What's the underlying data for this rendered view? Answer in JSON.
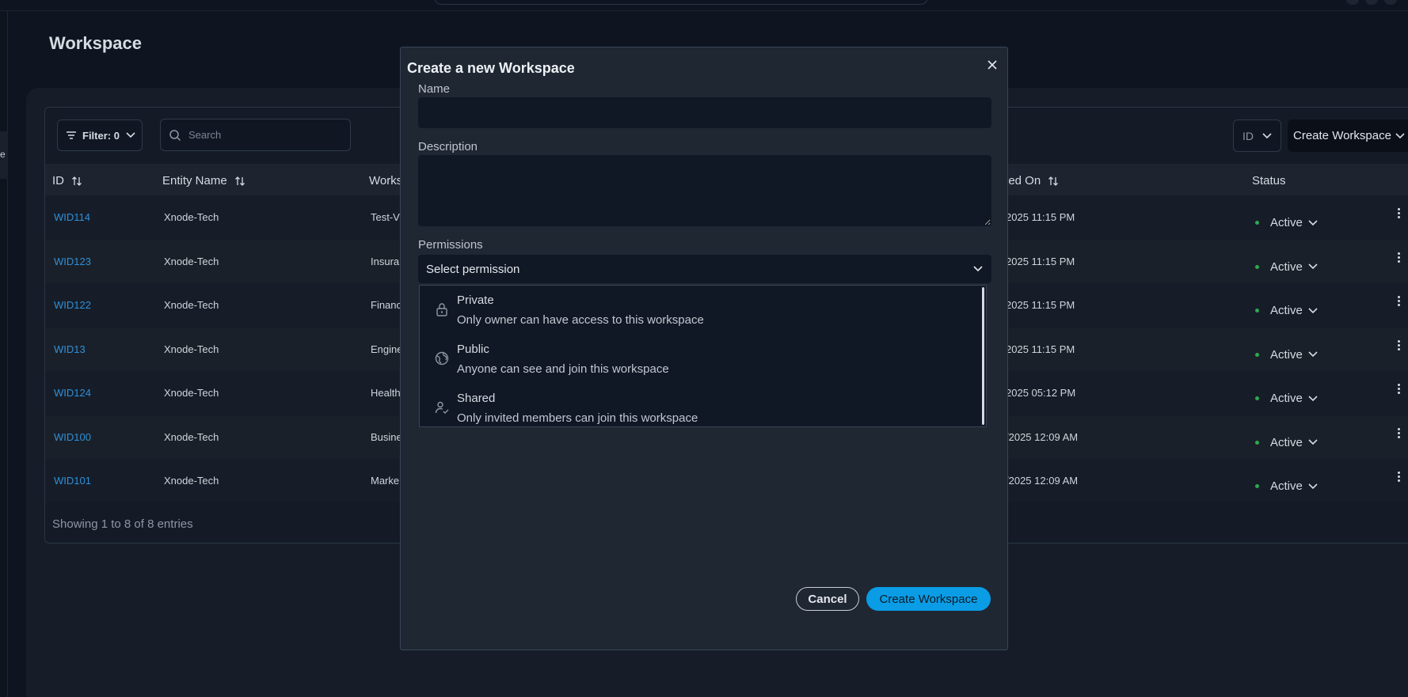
{
  "page": {
    "title": "Workspace"
  },
  "toolbar": {
    "filter_label": "Filter: 0",
    "search_placeholder": "Search",
    "id_select_value": "ID",
    "create_label": "Create Workspace"
  },
  "table": {
    "headers": {
      "id": "ID",
      "entity": "Entity Name",
      "workspace": "Works",
      "modified": "ied On",
      "status": "Status"
    },
    "rows": [
      {
        "id": "WID114",
        "entity": "Xnode-Tech",
        "workspace": "Test-V",
        "date": "2025 11:15 PM",
        "status": "Active"
      },
      {
        "id": "WID123",
        "entity": "Xnode-Tech",
        "workspace": "Insura",
        "date": "2025 11:15 PM",
        "status": "Active"
      },
      {
        "id": "WID122",
        "entity": "Xnode-Tech",
        "workspace": "Financ",
        "date": "2025 11:15 PM",
        "status": "Active"
      },
      {
        "id": "WID13",
        "entity": "Xnode-Tech",
        "workspace": "Engine",
        "date": "2025 11:15 PM",
        "status": "Active"
      },
      {
        "id": "WID124",
        "entity": "Xnode-Tech",
        "workspace": "Health",
        "date": "2025 05:12 PM",
        "status": "Active"
      },
      {
        "id": "WID100",
        "entity": "Xnode-Tech",
        "workspace": "Busine",
        "date": "/2025 12:09 AM",
        "status": "Active"
      },
      {
        "id": "WID101",
        "entity": "Xnode-Tech",
        "workspace": "Marke",
        "date": "/2025 12:09 AM",
        "status": "Active"
      }
    ],
    "footer": "Showing 1 to 8 of 8 entries"
  },
  "modal": {
    "title": "Create a new Workspace",
    "name_label": "Name",
    "name_value": "",
    "description_label": "Description",
    "description_value": "",
    "permissions_label": "Permissions",
    "permissions_placeholder": "Select permission",
    "options": [
      {
        "title": "Private",
        "description": "Only owner can have access to this workspace",
        "icon": "lock-icon"
      },
      {
        "title": "Public",
        "description": "Anyone can see and join this workspace",
        "icon": "globe-icon"
      },
      {
        "title": "Shared",
        "description": "Only invited members can join this workspace",
        "icon": "user-check-icon"
      }
    ],
    "cancel_label": "Cancel",
    "create_label": "Create Workspace"
  },
  "sidebar": {
    "tab_glyph": "e"
  },
  "colors": {
    "accent": "#0a9de6",
    "link": "#2f8fd8",
    "status_active": "#2ea84f",
    "background": "#0f1520",
    "modal_bg": "#1f2733"
  }
}
